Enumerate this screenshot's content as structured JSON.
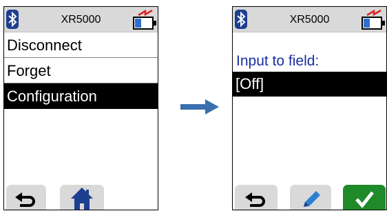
{
  "left_screen": {
    "device_name": "XR5000",
    "menu": [
      {
        "label": "Disconnect",
        "selected": false
      },
      {
        "label": "Forget",
        "selected": false
      },
      {
        "label": "Configuration",
        "selected": true
      }
    ],
    "softkeys": {
      "left": "back-icon",
      "right": "home-icon"
    }
  },
  "right_screen": {
    "device_name": "XR5000",
    "field_label": "Input to field:",
    "field_value": "[Off]",
    "softkeys": {
      "left": "back-icon",
      "middle": "pencil-icon",
      "right": "checkmark-icon"
    }
  },
  "colors": {
    "status_bar": "#d9d9d9",
    "selection": "#000000",
    "field_label": "#1a2ea0",
    "arrow": "#3a6fb0",
    "ok_button": "#1f8a2a"
  }
}
